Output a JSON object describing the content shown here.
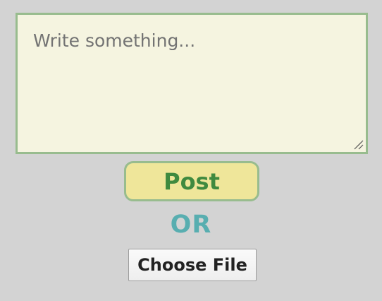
{
  "composer": {
    "placeholder": "Write something..."
  },
  "actions": {
    "post_label": "Post",
    "separator_label": "OR",
    "choose_file_label": "Choose File"
  },
  "colors": {
    "background": "#d3d3d3",
    "textarea_border": "#98bc8e",
    "textarea_background": "#f5f4e0",
    "post_background": "#efe69a",
    "post_text": "#3f8a3f",
    "or_text": "#58aeb0"
  },
  "icons": {
    "resize_handle": "resize-handle-icon"
  }
}
